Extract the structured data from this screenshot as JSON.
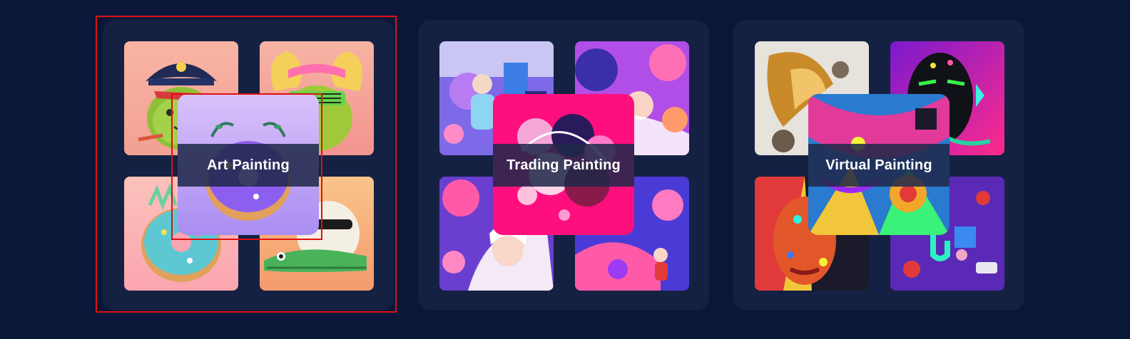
{
  "categories": [
    {
      "label": "Art Painting",
      "theme": "cartoon-characters"
    },
    {
      "label": "Trading Painting",
      "theme": "colorful-illustrations"
    },
    {
      "label": "Virtual Painting",
      "theme": "abstract-portraits"
    }
  ],
  "selection_color": "#e01010",
  "background_color": "#0b1739",
  "card_color": "#152142"
}
